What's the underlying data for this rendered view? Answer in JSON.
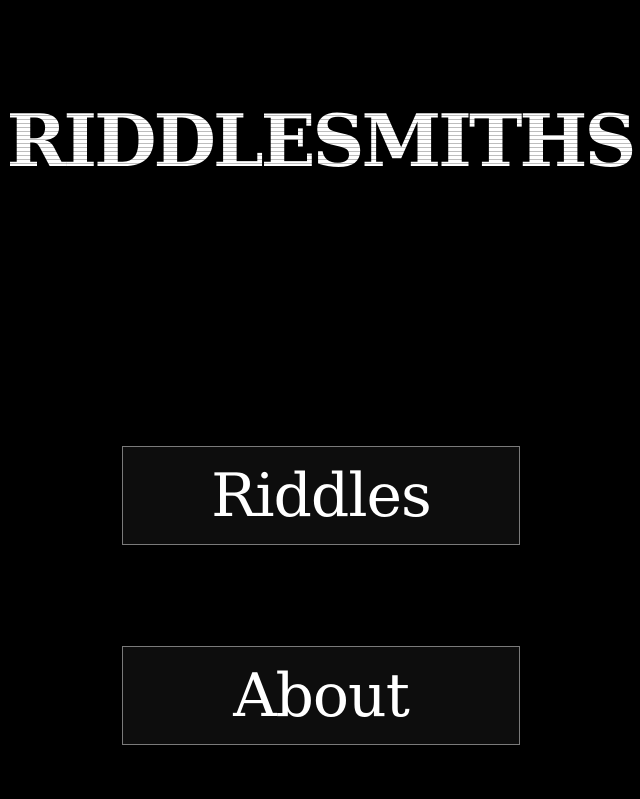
{
  "app": {
    "title": "RIDDLESMITHS"
  },
  "menu": {
    "riddles_label": "Riddles",
    "about_label": "About"
  },
  "colors": {
    "background": "#000000",
    "button_border": "#7a7a7a",
    "text": "#ffffff"
  }
}
